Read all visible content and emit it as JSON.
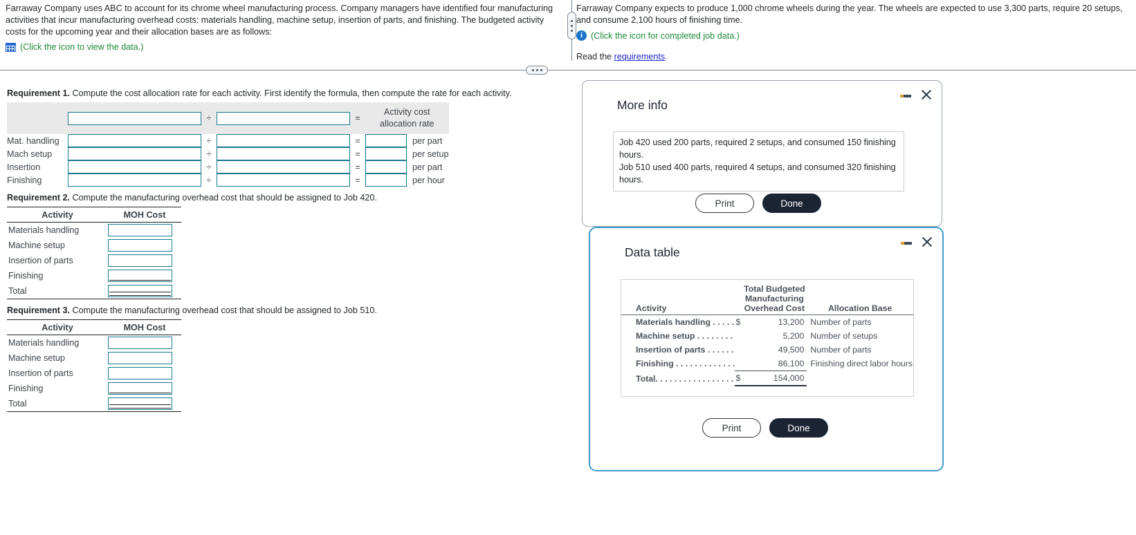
{
  "left_panel": {
    "paragraph": "Farraway Company uses ABC to account for its chrome wheel manufacturing process. Company managers have identified four manufacturing activities that incur manufacturing overhead costs: materials handling, machine setup, insertion of parts, and finishing. The budgeted activity costs for the upcoming year and their allocation bases are as follows:",
    "icon_name": "data-table-icon",
    "icon_note": "(Click the icon to view the data.)"
  },
  "right_panel": {
    "paragraph": "Farraway Company expects to produce 1,000 chrome wheels during the year. The wheels are expected to use 3,300 parts, require 20 setups, and consume 2,100 hours of finishing time.",
    "icon_name": "info-icon",
    "icon_note": "(Click the icon for completed job data.)",
    "read_prefix": "Read the ",
    "read_link": "requirements",
    "read_suffix": "."
  },
  "requirement1": {
    "label": "Requirement 1.",
    "text": " Compute the cost allocation rate for each activity. First identify the formula, then compute the rate for each activity.",
    "header_line1": "Activity cost",
    "header_line2": "allocation rate",
    "divide_symbol": "÷",
    "equals_symbol": "=",
    "rows": [
      {
        "label": "Mat. handling",
        "unit": "per part"
      },
      {
        "label": "Mach setup",
        "unit": "per setup"
      },
      {
        "label": "Insertion",
        "unit": "per part"
      },
      {
        "label": "Finishing",
        "unit": "per hour"
      }
    ]
  },
  "requirement2": {
    "label": "Requirement 2.",
    "text": " Compute the manufacturing overhead cost that should be assigned to Job 420.",
    "columns": [
      "Activity",
      "MOH Cost"
    ],
    "rows": [
      "Materials handling",
      "Machine setup",
      "Insertion of parts",
      "Finishing",
      "Total"
    ]
  },
  "requirement3": {
    "label": "Requirement 3.",
    "text": " Compute the manufacturing overhead cost that should be assigned to Job 510.",
    "columns": [
      "Activity",
      "MOH Cost"
    ],
    "rows": [
      "Materials handling",
      "Machine setup",
      "Insertion of parts",
      "Finishing",
      "Total"
    ]
  },
  "more_info_dialog": {
    "title": "More info",
    "line1": "Job 420 used 200 parts, required 2 setups, and consumed 150 finishing hours.",
    "line2": "Job 510 used 400 parts, required 4 setups, and consumed 320 finishing hours.",
    "print_label": "Print",
    "done_label": "Done"
  },
  "data_table_dialog": {
    "title": "Data table",
    "print_label": "Print",
    "done_label": "Done",
    "table": {
      "col_activity": "Activity",
      "col_cost_l1": "Total Budgeted",
      "col_cost_l2": "Manufacturing",
      "col_cost_l3": "Overhead Cost",
      "col_base": "Allocation Base",
      "rows": [
        {
          "activity": "Materials handling . . . . .",
          "currency": "$",
          "amount": "13,200",
          "base": "Number of parts"
        },
        {
          "activity": "Machine setup . . . . . . . .",
          "currency": "",
          "amount": "5,200",
          "base": "Number of setups"
        },
        {
          "activity": "Insertion of parts . . . . . .",
          "currency": "",
          "amount": "49,500",
          "base": "Number of parts"
        },
        {
          "activity": "Finishing . . . . . . . . . . . . .",
          "currency": "",
          "amount": "86,100",
          "base": "Finishing direct labor hours"
        }
      ],
      "total": {
        "activity": "Total. . . . . . . . . . . . . . . . .",
        "currency": "$",
        "amount": "154,000",
        "base": ""
      }
    }
  },
  "window_controls": {
    "minimize_name": "minimize-icon",
    "close_name": "close-icon"
  },
  "colors": {
    "input_border": "#17788f",
    "dialog_accent": "#3d9bc9",
    "done_button": "#1b2432",
    "link": "#2222cc",
    "note_green": "#1f8a3b"
  }
}
